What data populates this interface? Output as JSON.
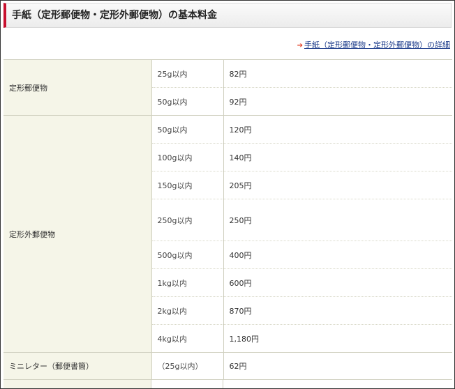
{
  "header": {
    "title": "手紙（定形郵便物・定形外郵便物）の基本料金"
  },
  "detail_link": {
    "label": "手紙（定形郵便物・定形外郵便物）の詳細"
  },
  "rows": [
    {
      "category": "定形郵便物",
      "weight": "25g以内",
      "price": "82円"
    },
    {
      "weight": "50g以内",
      "price": "92円"
    },
    {
      "category": "定形外郵便物",
      "weight": "50g以内",
      "price": "120円"
    },
    {
      "weight": "100g以内",
      "price": "140円"
    },
    {
      "weight": "150g以内",
      "price": "205円"
    },
    {
      "weight": "250g以内",
      "price": "250円"
    },
    {
      "weight": "500g以内",
      "price": "400円"
    },
    {
      "weight": "1kg以内",
      "price": "600円"
    },
    {
      "weight": "2kg以内",
      "price": "870円"
    },
    {
      "weight": "4kg以内",
      "price": "1,180円"
    },
    {
      "category": "ミニレター（郵便書簡）",
      "weight": "（25g以内）",
      "price": "62円"
    }
  ],
  "colors": {
    "accent": "#c8102e",
    "category_bg": "#f5f5e8",
    "link": "#1a3a8a"
  },
  "icons": {
    "link_arrow": "arrow-right-icon"
  }
}
